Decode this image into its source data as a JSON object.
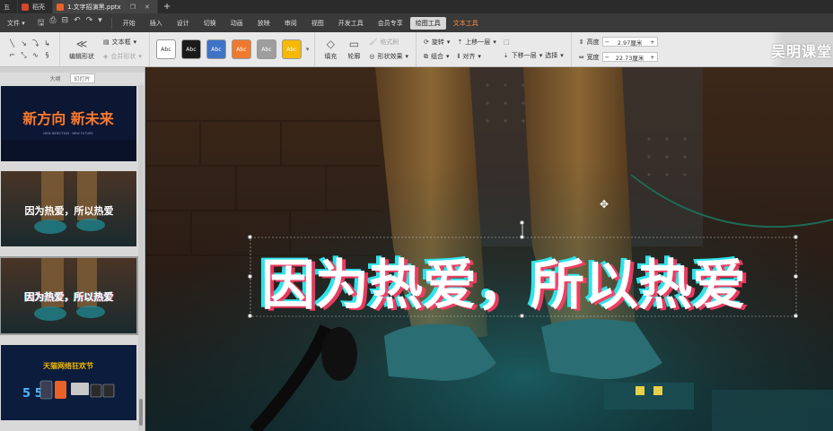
{
  "tabs": [
    {
      "label": "五",
      "icon_color": "#555555"
    },
    {
      "label": "稻壳",
      "icon_color": "#d6452f"
    },
    {
      "label": "1.文字招演黑.pptx",
      "icon_color": "#e8632c"
    }
  ],
  "menu": {
    "file": "文件",
    "items": [
      "开始",
      "插入",
      "设计",
      "切换",
      "动画",
      "放映",
      "审阅",
      "视图",
      "开发工具",
      "会员专享"
    ],
    "drawing_tools": "绘图工具",
    "text_tools": "文本工具"
  },
  "ribbon": {
    "edit_shape": "编辑形状",
    "text_box": "文本框",
    "merge_shape": "合并形状",
    "style_swatches": [
      {
        "label": "Abc",
        "bg": "#ffffff",
        "fg": "#333333"
      },
      {
        "label": "Abc",
        "bg": "#1a1a1a",
        "fg": "#ffffff"
      },
      {
        "label": "Abc",
        "bg": "#3f73c8",
        "fg": "#ffffff"
      },
      {
        "label": "Abc",
        "bg": "#ef7a2f",
        "fg": "#ffffff"
      },
      {
        "label": "Abc",
        "bg": "#9e9e9e",
        "fg": "#ffffff"
      },
      {
        "label": "Abc",
        "bg": "#f6b800",
        "fg": "#ffffff"
      }
    ],
    "fill": "填充",
    "outline": "轮廓",
    "format_painter": "格式刷",
    "shape_effects": "形状效果",
    "rotate": "旋转",
    "align": "对齐",
    "group": "组合",
    "bring_forward": "上移一层",
    "send_backward": "下移一层",
    "select": "选择",
    "height_label": "高度",
    "width_label": "宽度",
    "height_value": "2.97厘米",
    "width_value": "22.73厘米"
  },
  "brand": "吴明课堂",
  "left_panel": {
    "tab_outline": "大纲",
    "tab_slides": "幻灯片"
  },
  "slides": [
    {
      "title": "新方向 新未来",
      "subtitle": "NEW DIRECTION · NEW FUTURE"
    },
    {
      "title": "因为热爱，所以热爱"
    },
    {
      "title": "因为热爱，所以热爱"
    },
    {
      "title": "天猫网络狂欢节",
      "numbers": "5 5"
    }
  ],
  "canvas_text": "因为热爱，所以热爱",
  "colors": {
    "glitch_cyan": "#2fe3ea",
    "glitch_red": "#ff3c64",
    "accent_orange": "#ff8a3d"
  }
}
